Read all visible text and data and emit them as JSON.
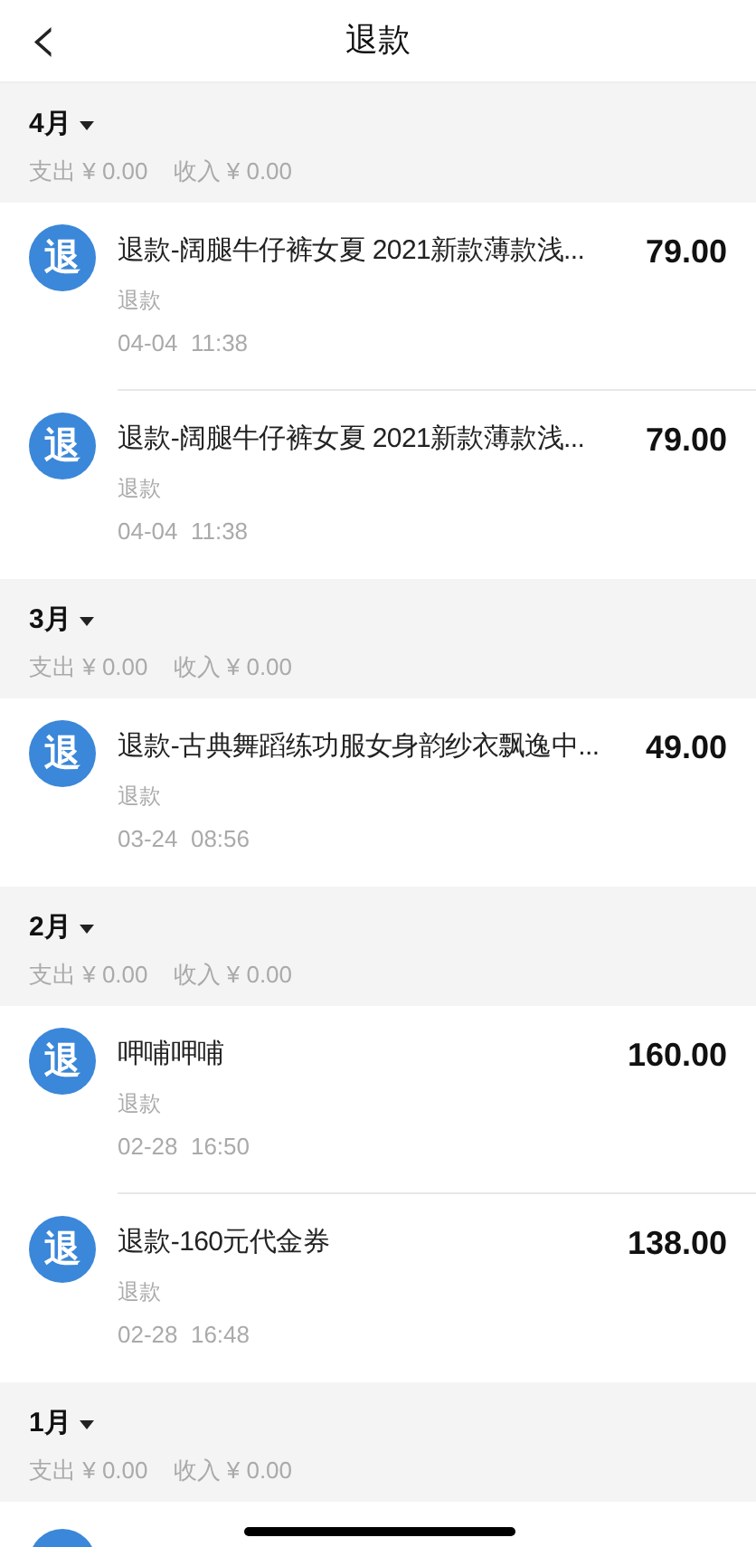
{
  "header": {
    "back": "‹",
    "title": "退款"
  },
  "months": [
    {
      "label": "4月",
      "summary": [
        {
          "label": "支出",
          "value": "¥ 0.00"
        },
        {
          "label": "收入",
          "value": "¥ 0.00"
        }
      ],
      "items": [
        {
          "kind": "entry",
          "icon": "退",
          "title": "退款-阔腿牛仔裤女夏 2021新款薄款浅...",
          "category": "退款",
          "time": "04-04  11:38",
          "amount": "79.00"
        },
        {
          "kind": "entry",
          "icon": "退",
          "title": "退款-阔腿牛仔裤女夏 2021新款薄款浅...",
          "category": "退款",
          "time": "04-04  11:38",
          "amount": "79.00"
        }
      ]
    },
    {
      "label": "3月",
      "summary": [
        {
          "label": "支出",
          "value": "¥ 0.00"
        },
        {
          "label": "收入",
          "value": "¥ 0.00"
        }
      ],
      "items": [
        {
          "kind": "entry",
          "icon": "退",
          "title": "退款-古典舞蹈练功服女身韵纱衣飘逸中...",
          "category": "退款",
          "time": "03-24  08:56",
          "amount": "49.00"
        }
      ]
    },
    {
      "label": "2月",
      "summary": [
        {
          "label": "支出",
          "value": "¥ 0.00"
        },
        {
          "label": "收入",
          "value": "¥ 0.00"
        }
      ],
      "items": [
        {
          "kind": "entry",
          "icon": "退",
          "title": "呷哺呷哺",
          "category": "退款",
          "time": "02-28  16:50",
          "amount": "160.00"
        },
        {
          "kind": "entry",
          "icon": "退",
          "title": "退款-160元代金券",
          "category": "退款",
          "time": "02-28  16:48",
          "amount": "138.00"
        }
      ]
    },
    {
      "label": "1月",
      "summary": [
        {
          "label": "支出",
          "value": "¥ 0.00"
        },
        {
          "label": "收入",
          "value": "¥ 0.00"
        }
      ],
      "items": [
        {
          "kind": "cut"
        }
      ]
    }
  ]
}
